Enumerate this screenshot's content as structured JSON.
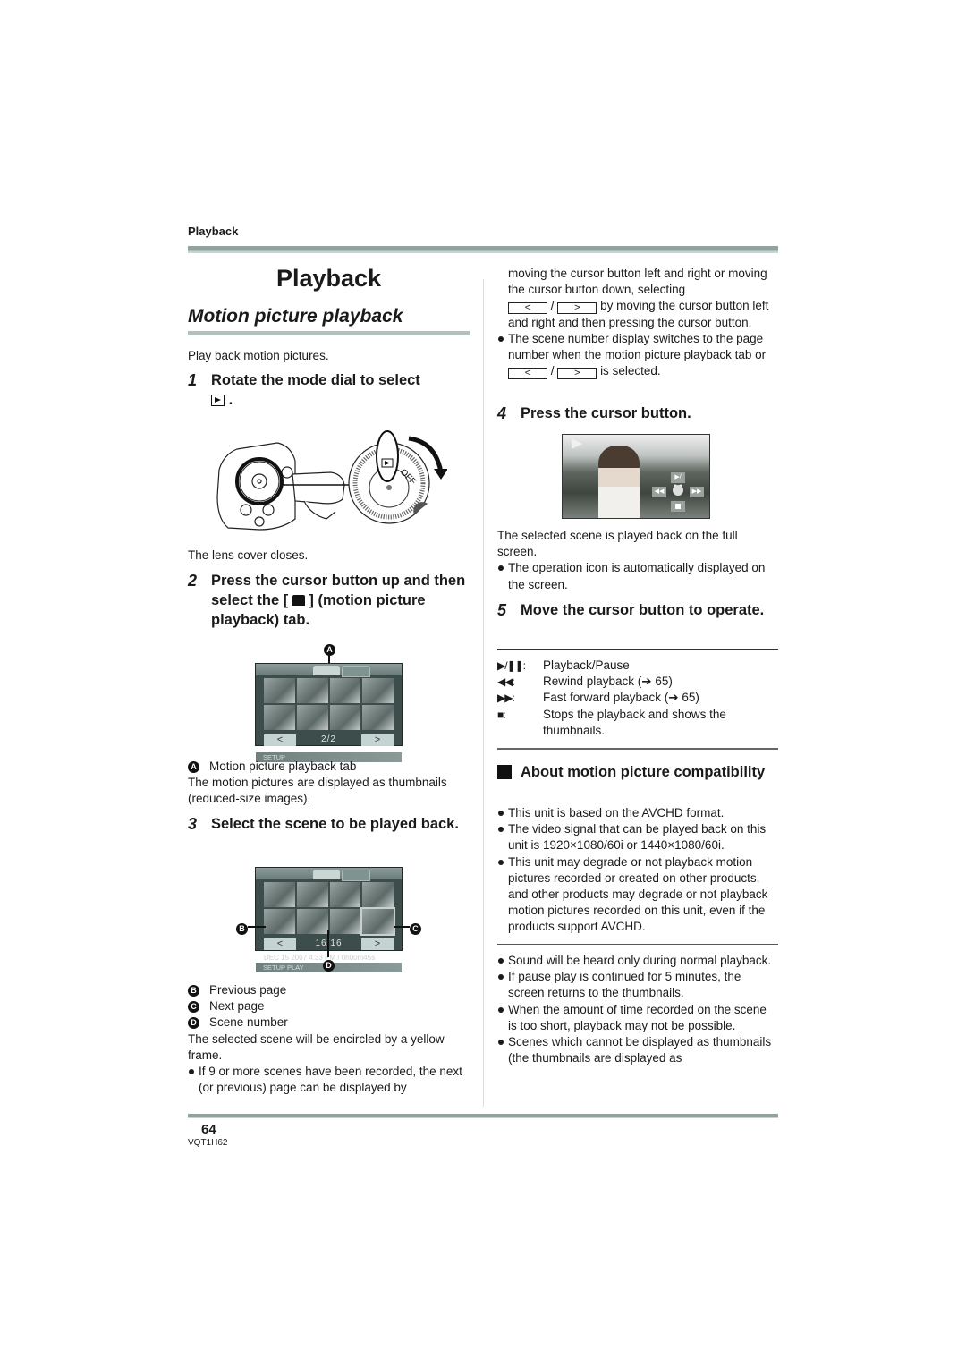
{
  "header": {
    "running_head": "Playback",
    "page_title": "Playback",
    "section_title": "Motion picture playback",
    "intro": "Play back motion pictures."
  },
  "left_column": {
    "step1": {
      "num": "1",
      "text": "Rotate the mode dial to select",
      "after_icon": ".",
      "icon": "play-mode-icon"
    },
    "step1_note": "The lens cover closes.",
    "step2": {
      "num": "2",
      "text_before": "Press the cursor button up and then select the [",
      "text_after": "] (motion picture playback) tab.",
      "icon": "motion-picture-icon"
    },
    "screen1": {
      "page_count": "2/2",
      "setup_label": "SETUP",
      "callout_a": "A"
    },
    "callout_a_label": "Motion picture playback tab",
    "thumbnails_note": "The motion pictures are displayed as thumbnails (reduced-size images).",
    "step3": {
      "num": "3",
      "text": "Select the scene to be played back."
    },
    "screen2": {
      "scene_count": "16/16",
      "info_line": "DEC 15 2007  4:33 PM / 0h00m45s",
      "bottom_line": "SETUP  PLAY",
      "callout_b": "B",
      "callout_c": "C",
      "callout_d": "D"
    },
    "callouts": [
      {
        "letter": "B",
        "label": "Previous page"
      },
      {
        "letter": "C",
        "label": "Next page"
      },
      {
        "letter": "D",
        "label": "Scene number"
      }
    ],
    "yellow_frame_note": "The selected scene will be encircled by a yellow frame.",
    "bullet_9_scenes": "If 9 or more scenes have been recorded, the next (or previous) page can be displayed by"
  },
  "right_column": {
    "cont_text_1": "moving the cursor button left and right or moving the cursor button down, selecting",
    "btn_prev": "<",
    "btn_next": ">",
    "slash": "/",
    "cont_text_2": "by moving the cursor button left and right and then pressing the cursor button.",
    "bullet_scene_number": "The scene number display switches to the page number when the motion picture playback tab or",
    "bullet_scene_number_end": "is selected.",
    "step4": {
      "num": "4",
      "text": "Press the cursor button."
    },
    "step4_note": "The selected scene is played back on the full screen.",
    "step4_bullet": "The operation icon is automatically displayed on the screen.",
    "step5": {
      "num": "5",
      "text": "Move the cursor button to operate."
    },
    "controls": [
      {
        "symbol": "▶/❚❚:",
        "icon": "play-pause-icon",
        "label": "Playback/Pause"
      },
      {
        "symbol": "◀◀:",
        "icon": "rewind-icon",
        "label": "Rewind playback (➔ 65)"
      },
      {
        "symbol": "▶▶:",
        "icon": "fast-forward-icon",
        "label": "Fast forward playback (➔ 65)"
      },
      {
        "symbol": "■:",
        "icon": "stop-icon",
        "label": "Stops the playback and shows the thumbnails."
      }
    ],
    "compat_heading": "About motion picture compatibility",
    "compat_bullets": [
      "This unit is based on the AVCHD format.",
      "The video signal that can be played back on this unit is 1920×1080/60i or 1440×1080/60i.",
      "This unit may degrade or not playback motion pictures recorded or created on other products, and other products may degrade or not playback motion pictures recorded on this unit, even if the products support AVCHD."
    ],
    "misc_bullets": [
      "Sound will be heard only during normal playback.",
      "If pause play is continued for 5 minutes, the screen returns to the thumbnails.",
      "When the amount of time recorded on the scene is too short, playback may not be possible.",
      "Scenes which cannot be displayed as thumbnails (the thumbnails are displayed as"
    ]
  },
  "footer": {
    "page_number": "64",
    "doc_code": "VQT1H62"
  }
}
